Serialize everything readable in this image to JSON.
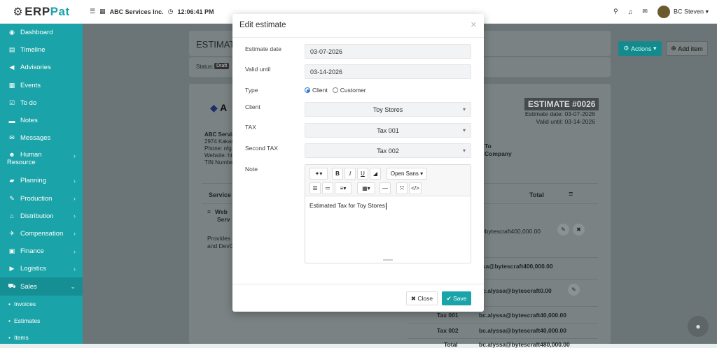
{
  "brand": {
    "name_a": "ERP",
    "name_b": "at",
    "accent": "#1aa3a8"
  },
  "topbar": {
    "company": "ABC Services Inc.",
    "time": "12:06:41 PM",
    "user": "BC Steven"
  },
  "sidebar": {
    "items": [
      {
        "label": "Dashboard",
        "icon": "dashboard-icon"
      },
      {
        "label": "Timeline",
        "icon": "timeline-icon"
      },
      {
        "label": "Advisories",
        "icon": "megaphone-icon"
      },
      {
        "label": "Events",
        "icon": "calendar-icon"
      },
      {
        "label": "To do",
        "icon": "checkbox-icon"
      },
      {
        "label": "Notes",
        "icon": "note-icon"
      },
      {
        "label": "Messages",
        "icon": "envelope-icon"
      },
      {
        "label": "Human Resource",
        "icon": "users-icon"
      },
      {
        "label": "Planning",
        "icon": "car-icon"
      },
      {
        "label": "Production",
        "icon": "wrench-icon"
      },
      {
        "label": "Distribution",
        "icon": "bank-icon"
      },
      {
        "label": "Compensation",
        "icon": "money-icon"
      },
      {
        "label": "Finance",
        "icon": "finance-icon"
      },
      {
        "label": "Logistics",
        "icon": "truck-icon"
      },
      {
        "label": "Sales",
        "icon": "cart-icon"
      }
    ],
    "sub_items": [
      "Invoices",
      "Estimates",
      "Items"
    ]
  },
  "background": {
    "header_title": "ESTIMATE",
    "actions_label": "Actions",
    "add_item_label": "Add item",
    "status_label": "Status:",
    "status_value": "Draft",
    "logo_letter": "A",
    "company_lines": [
      "ABC Servic",
      "2974 Kakar",
      "Phone: nfg",
      "Website: ht",
      "TIN Numbe"
    ],
    "estimate_no": "ESTIMATE #0026",
    "estimate_date": "Estimate date: 03-07-2026",
    "valid_until": "Valid until: 03-14-2026",
    "bill_to_a": "To",
    "bill_to_b": "Company",
    "col_service": "Service",
    "col_total": "Total",
    "svc_name_1": "Web",
    "svc_name_2": "Serv",
    "svc_desc_1": "Provides",
    "svc_desc_2": "and DevO",
    "row1_total": "@bytescraft400,000.00",
    "row2_total": "ssa@bytescraft400,000.00",
    "row3_total": "bc.alyssa@bytescraft0.00",
    "tax1_label": "Tax 001",
    "tax1_value": "bc.alyssa@bytescraft40,000.00",
    "tax2_label": "Tax 002",
    "tax2_value": "bc.alyssa@bytescraft40,000.00",
    "total_label": "Total",
    "total_value": "bc.alyssa@bytescraft480,000.00"
  },
  "modal": {
    "title": "Edit estimate",
    "estimate_date_label": "Estimate date",
    "estimate_date_value": "03-07-2026",
    "valid_until_label": "Valid until",
    "valid_until_value": "03-14-2026",
    "type_label": "Type",
    "type_client": "Client",
    "type_customer": "Customer",
    "client_label": "Client",
    "client_value": "Toy Stores",
    "tax_label": "TAX",
    "tax_value": "Tax 001",
    "second_tax_label": "Second TAX",
    "second_tax_value": "Tax 002",
    "note_label": "Note",
    "font_label": "Open Sans",
    "note_text": "Estimated Tax for Toy Stores",
    "close_label": "Close",
    "save_label": "Save"
  }
}
